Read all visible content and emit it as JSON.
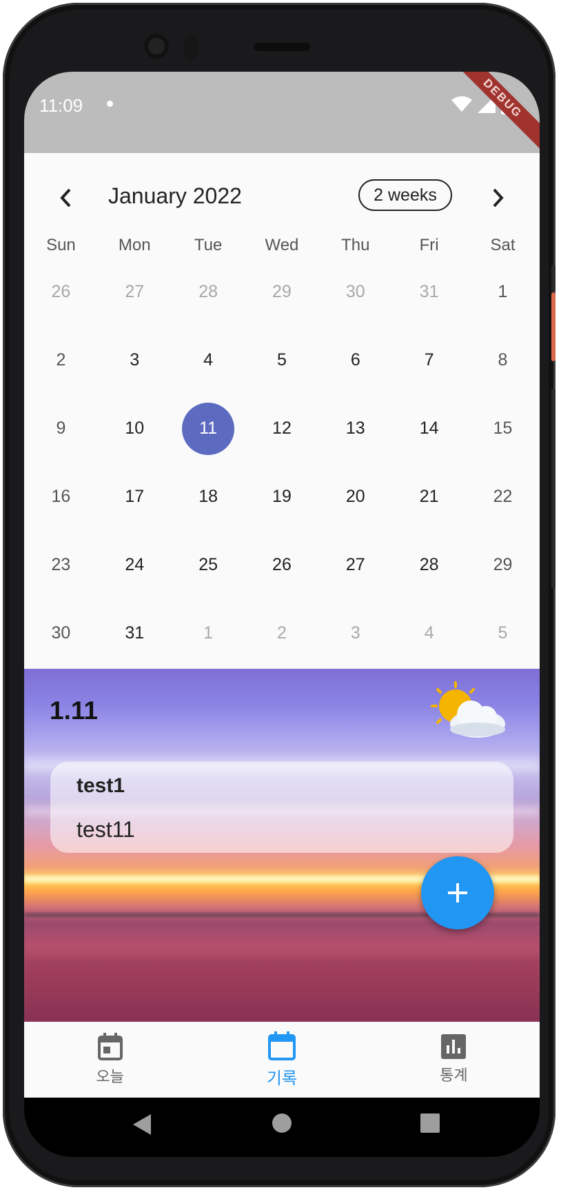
{
  "status_bar": {
    "time": "11:09",
    "debug_banner": "DEBUG"
  },
  "calendar": {
    "month_title": "January 2022",
    "format_button": "2 weeks",
    "days_of_week": [
      "Sun",
      "Mon",
      "Tue",
      "Wed",
      "Thu",
      "Fri",
      "Sat"
    ],
    "weeks": [
      [
        "26",
        "27",
        "28",
        "29",
        "30",
        "31",
        "1"
      ],
      [
        "2",
        "3",
        "4",
        "5",
        "6",
        "7",
        "8"
      ],
      [
        "9",
        "10",
        "11",
        "12",
        "13",
        "14",
        "15"
      ],
      [
        "16",
        "17",
        "18",
        "19",
        "20",
        "21",
        "22"
      ],
      [
        "23",
        "24",
        "25",
        "26",
        "27",
        "28",
        "29"
      ],
      [
        "30",
        "31",
        "1",
        "2",
        "3",
        "4",
        "5"
      ]
    ],
    "selected_day": "11"
  },
  "day_detail": {
    "date_label": "1.11",
    "weather_icon": "partly-cloudy-icon",
    "entry": {
      "title": "test1",
      "body": "test11"
    }
  },
  "fab": {
    "icon": "plus-icon"
  },
  "bottom_nav": {
    "items": [
      {
        "label": "오늘",
        "icon": "calendar-today-icon",
        "active": false
      },
      {
        "label": "기록",
        "icon": "calendar-icon",
        "active": true
      },
      {
        "label": "통계",
        "icon": "bar-chart-icon",
        "active": false
      }
    ]
  },
  "colors": {
    "accent": "#2196f3",
    "selected_day": "#5c6bc0",
    "debug_ribbon": "#a0332e"
  }
}
